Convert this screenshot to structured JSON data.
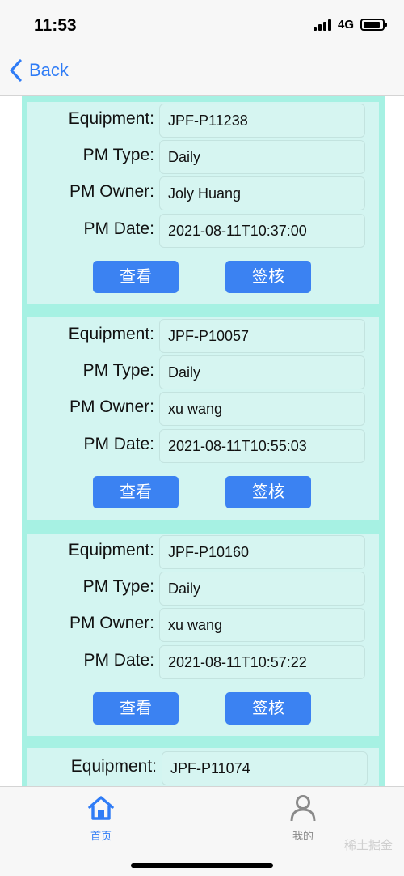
{
  "status_bar": {
    "time": "11:53",
    "network": "4G"
  },
  "nav": {
    "back_label": "Back"
  },
  "records": [
    {
      "equipment": "JPF-P11238",
      "pm_type": "Daily",
      "pm_owner": "Joly Huang",
      "pm_date": "2021-08-11T10:37:00"
    },
    {
      "equipment": "JPF-P10057",
      "pm_type": "Daily",
      "pm_owner": "xu wang",
      "pm_date": "2021-08-11T10:55:03"
    },
    {
      "equipment": "JPF-P10160",
      "pm_type": "Daily",
      "pm_owner": "xu wang",
      "pm_date": "2021-08-11T10:57:22"
    },
    {
      "equipment": "JPF-P11074"
    }
  ],
  "labels": {
    "equipment": "Equipment:",
    "pm_type": "PM Type:",
    "pm_owner": "PM Owner:",
    "pm_date": "PM Date:",
    "view": "查看",
    "sign": "签核"
  },
  "tab_bar": {
    "home_label": "首页",
    "mine_label": "我的",
    "active_color": "#2f7cf6",
    "inactive_color": "#8a8a8a"
  },
  "watermark": "稀土掘金",
  "colors": {
    "accent": "#3b82f2",
    "card_bg": "#d3f5f1",
    "list_bg": "#a6f1e3"
  }
}
